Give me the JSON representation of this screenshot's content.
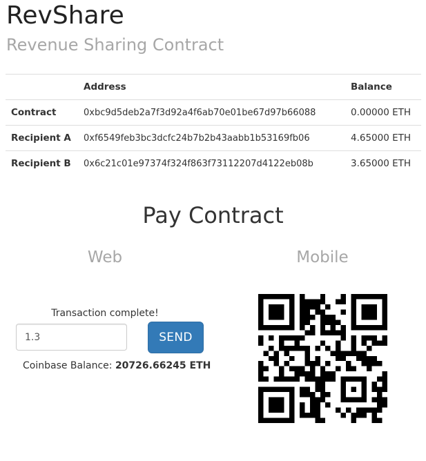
{
  "app": {
    "title": "RevShare",
    "subtitle": "Revenue Sharing Contract"
  },
  "table": {
    "headers": [
      "",
      "Address",
      "Balance"
    ],
    "rows": [
      {
        "label": "Contract",
        "address": "0xbc9d5deb2a7f3d92a4f6ab70e01be67d97b66088",
        "balance": "0.00000 ETH"
      },
      {
        "label": "Recipient A",
        "address": "0xf6549feb3bc3dcfc24b7b2b43aabb1b53169fb06",
        "balance": "4.65000 ETH"
      },
      {
        "label": "Recipient B",
        "address": "0x6c21c01e97374f324f863f73112207d4122eb08b",
        "balance": "3.65000 ETH"
      }
    ]
  },
  "pay": {
    "title": "Pay Contract",
    "web_label": "Web",
    "mobile_label": "Mobile",
    "status": "Transaction complete!",
    "amount_value": "1.3",
    "send_label": "SEND",
    "coinbase_label": "Coinbase Balance:",
    "coinbase_value": "20726.66245 ETH"
  },
  "colors": {
    "primary_button": "#337ab7",
    "muted_text": "#a7a7a7",
    "border": "#dddddd"
  },
  "icons": {
    "qr": "qr-code"
  }
}
